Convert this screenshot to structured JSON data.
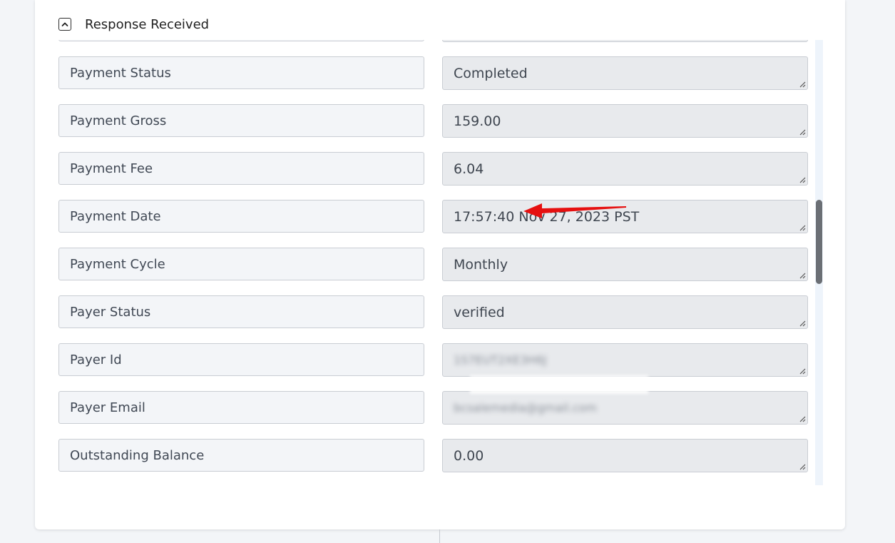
{
  "section": {
    "title": "Response Received",
    "toggle_icon": "chevron-up-icon"
  },
  "fields": [
    {
      "label": "Payment Status",
      "value": "Completed"
    },
    {
      "label": "Payment Gross",
      "value": "159.00"
    },
    {
      "label": "Payment Fee",
      "value": "6.04"
    },
    {
      "label": "Payment Date",
      "value": "17:57:40 Nov 27, 2023 PST"
    },
    {
      "label": "Payment Cycle",
      "value": "Monthly"
    },
    {
      "label": "Payer Status",
      "value": "verified"
    },
    {
      "label": "Payer Id",
      "value": "1S7EUT2XE3H6J"
    },
    {
      "label": "Payer Email",
      "value": "bcsalemedia@gmail.com"
    },
    {
      "label": "Outstanding Balance",
      "value": "0.00"
    }
  ],
  "annotation": {
    "arrow_color": "#e61010"
  },
  "colors": {
    "label_bg": "#f3f5f8",
    "value_bg": "#e8eaed",
    "border": "#c9cdd3",
    "scroll_thumb": "#6b6f75"
  }
}
